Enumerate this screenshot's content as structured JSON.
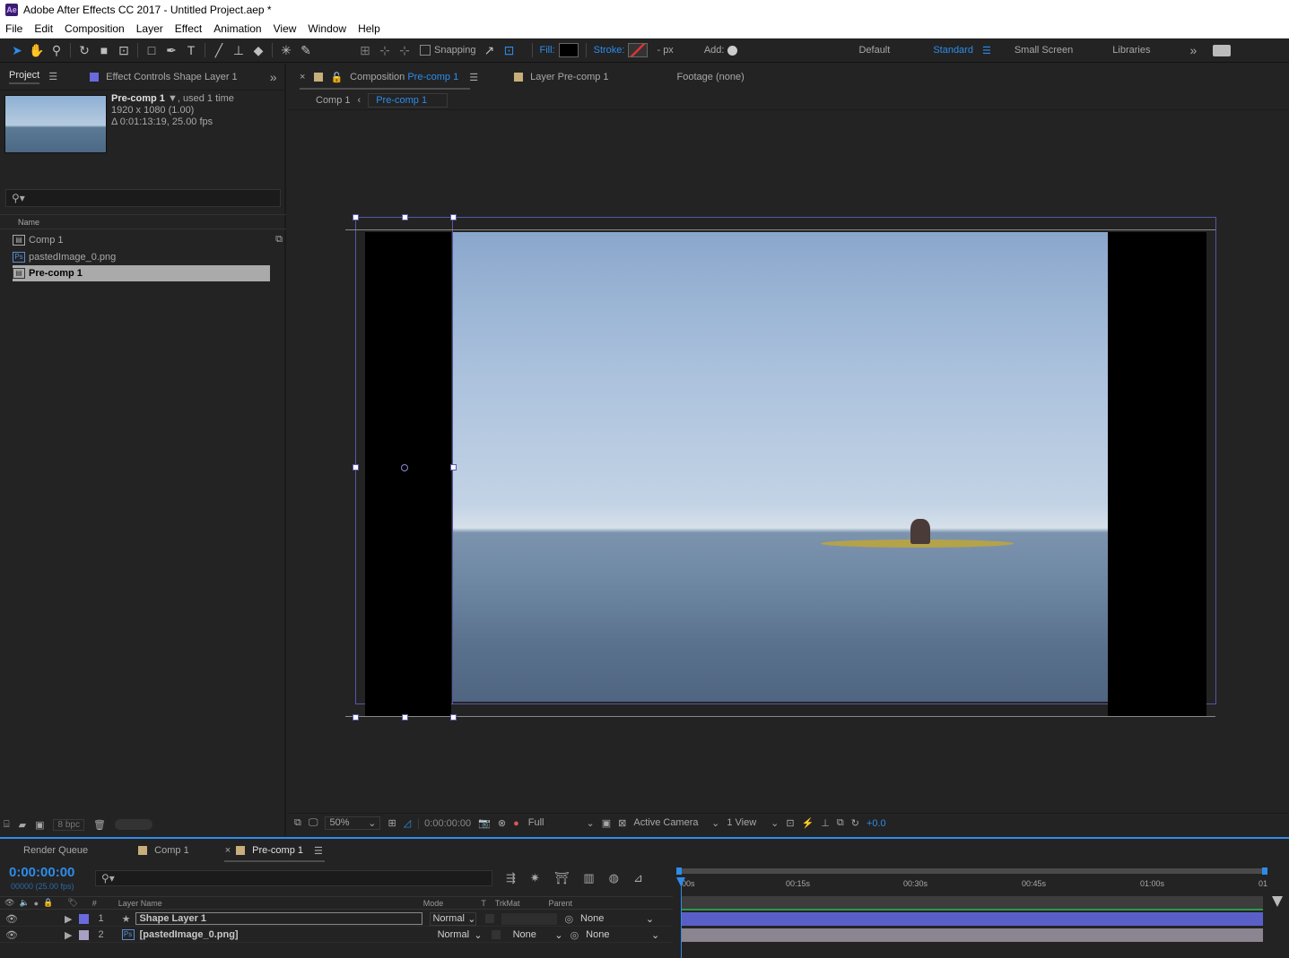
{
  "app": {
    "title": "Adobe After Effects CC 2017 - Untitled Project.aep *",
    "icon_text": "Ae"
  },
  "menu": [
    "File",
    "Edit",
    "Composition",
    "Layer",
    "Effect",
    "Animation",
    "View",
    "Window",
    "Help"
  ],
  "toolbar": {
    "snapping": "Snapping",
    "fill": "Fill:",
    "stroke": "Stroke:",
    "stroke_px": "- px",
    "add": "Add:",
    "workspaces": [
      "Default",
      "Standard",
      "Small Screen",
      "Libraries"
    ],
    "active_workspace": "Standard"
  },
  "project_panel": {
    "tab_project": "Project",
    "tab_effect": "Effect Controls Shape Layer 1",
    "item_name": "Pre-comp 1",
    "used": ", used 1 time",
    "dims": "1920 x 1080 (1.00)",
    "duration": "Δ 0:01:13:19, 25.00 fps",
    "search_icon": "search-icon",
    "col_name": "Name",
    "items": [
      {
        "name": "Comp 1",
        "type": "comp"
      },
      {
        "name": "pastedImage_0.png",
        "type": "ps"
      },
      {
        "name": "Pre-comp 1",
        "type": "comp",
        "selected": true
      }
    ],
    "bpc": "8 bpc"
  },
  "comp_panel": {
    "tab_composition": "Composition",
    "tab_composition_name": "Pre-comp 1",
    "tab_layer": "Layer",
    "tab_layer_name": "Pre-comp 1",
    "tab_footage": "Footage",
    "tab_footage_name": "(none)",
    "breadcrumb": [
      "Comp 1",
      "Pre-comp 1"
    ],
    "zoom": "50%",
    "timecode": "0:00:00:00",
    "resolution": "Full",
    "camera": "Active Camera",
    "view": "1 View",
    "exposure": "+0.0"
  },
  "timeline": {
    "tabs": [
      "Render Queue",
      "Comp 1",
      "Pre-comp 1"
    ],
    "current_time": "0:00:00:00",
    "fps_line": "00000 (25.00 fps)",
    "col_headers": {
      "num": "#",
      "layer": "Layer Name",
      "mode": "Mode",
      "t": "T",
      "trkmat": "TrkMat",
      "parent": "Parent"
    },
    "ruler": [
      "00s",
      "00:15s",
      "00:30s",
      "00:45s",
      "01:00s",
      "01"
    ],
    "layers": [
      {
        "num": "1",
        "name": "Shape Layer 1",
        "mode": "Normal",
        "trkmat": "",
        "parent": "None",
        "color": "#6a6ade"
      },
      {
        "num": "2",
        "name": "[pastedImage_0.png]",
        "mode": "Normal",
        "trkmat": "None",
        "parent": "None",
        "color": "#a79fc4"
      }
    ]
  },
  "colors": {
    "accent": "#2d8ceb",
    "panel": "#232323",
    "timeline_bar1": "#5a5fc8",
    "timeline_bar2": "#8a8590"
  }
}
